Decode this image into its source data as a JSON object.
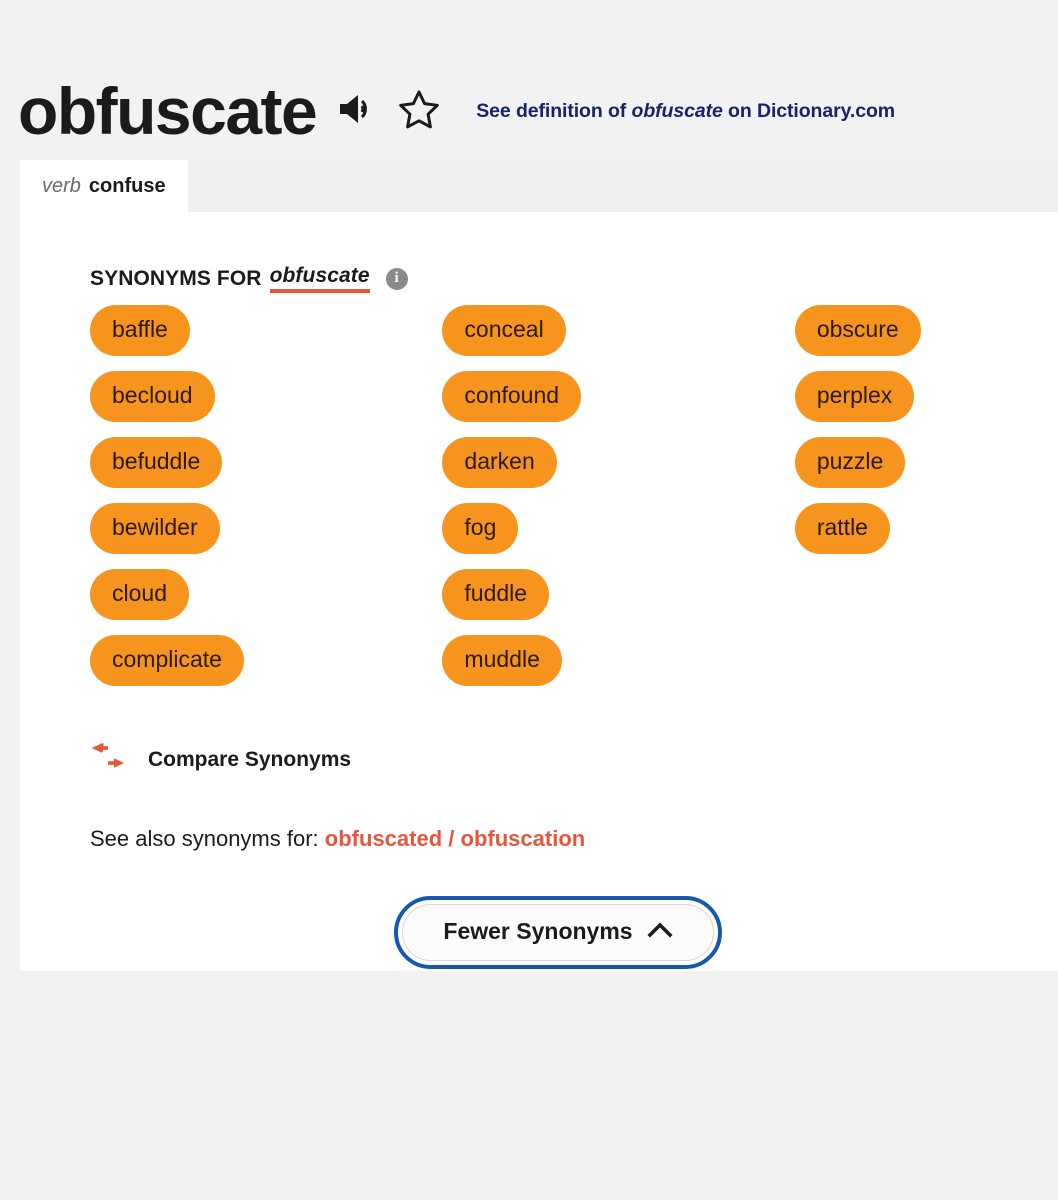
{
  "header": {
    "word": "obfuscate",
    "pronounce_icon": "speaker-icon",
    "favorite_icon": "star-icon",
    "definition_link": {
      "prefix": "See definition of ",
      "word": "obfuscate",
      "suffix": " on Dictionary.com",
      "color": "#16256b"
    }
  },
  "tabs": [
    {
      "pos": "verb",
      "sense": "confuse",
      "active": true
    }
  ],
  "synonyms_section": {
    "heading_prefix": "SYNONYMS FOR",
    "heading_word": "obfuscate",
    "info_icon_label": "i",
    "underline_color": "#e4573d",
    "pill_color": "#f7941d",
    "columns": [
      {
        "items": [
          "baffle",
          "becloud",
          "befuddle",
          "bewilder",
          "cloud",
          "complicate"
        ]
      },
      {
        "items": [
          "conceal",
          "confound",
          "darken",
          "fog",
          "fuddle",
          "muddle"
        ]
      },
      {
        "items": [
          "obscure",
          "perplex",
          "puzzle",
          "rattle"
        ]
      }
    ]
  },
  "compare": {
    "icon": "compare-arrows-icon",
    "label": "Compare Synonyms",
    "icon_color": "#e4573d"
  },
  "see_also": {
    "label": "See also synonyms for:",
    "links": [
      "obfuscated",
      "obfuscation"
    ],
    "separator": "/",
    "link_color": "#e4573d"
  },
  "toggle_button": {
    "label": "Fewer Synonyms",
    "chevron": "chevron-up-icon",
    "focus_ring_color": "#1558b0"
  }
}
